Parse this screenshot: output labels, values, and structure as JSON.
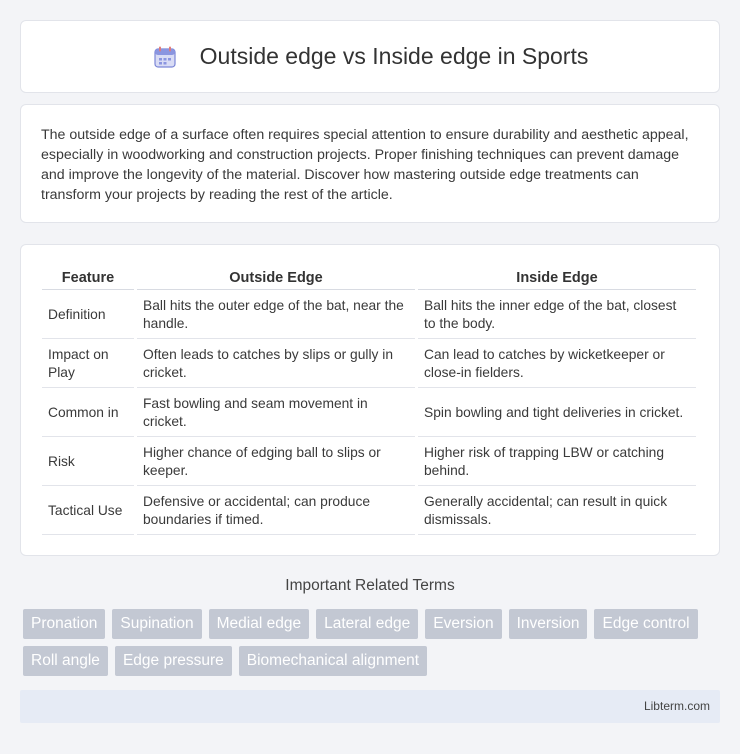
{
  "header": {
    "title": "Outside edge vs Inside edge in Sports",
    "icon": "calendar-icon"
  },
  "intro": {
    "text": "The outside edge of a surface often requires special attention to ensure durability and aesthetic appeal, especially in woodworking and construction projects. Proper finishing techniques can prevent damage and improve the longevity of the material. Discover how mastering outside edge treatments can transform your projects by reading the rest of the article."
  },
  "table": {
    "headers": [
      "Feature",
      "Outside Edge",
      "Inside Edge"
    ],
    "rows": [
      [
        "Definition",
        "Ball hits the outer edge of the bat, near the handle.",
        "Ball hits the inner edge of the bat, closest to the body."
      ],
      [
        "Impact on Play",
        "Often leads to catches by slips or gully in cricket.",
        "Can lead to catches by wicketkeeper or close-in fielders."
      ],
      [
        "Common in",
        "Fast bowling and seam movement in cricket.",
        "Spin bowling and tight deliveries in cricket."
      ],
      [
        "Risk",
        "Higher chance of edging ball to slips or keeper.",
        "Higher risk of trapping LBW or catching behind."
      ],
      [
        "Tactical Use",
        "Defensive or accidental; can produce boundaries if timed.",
        "Generally accidental; can result in quick dismissals."
      ]
    ]
  },
  "related": {
    "title": "Important Related Terms",
    "tags": [
      "Pronation",
      "Supination",
      "Medial edge",
      "Lateral edge",
      "Eversion",
      "Inversion",
      "Edge control",
      "Roll angle",
      "Edge pressure",
      "Biomechanical alignment"
    ]
  },
  "footer": {
    "site": "Libterm.com"
  },
  "colors": {
    "tag_bg": "#c3c8d3",
    "footer_bg": "#e6ebf5",
    "page_bg": "#f3f4f7"
  }
}
